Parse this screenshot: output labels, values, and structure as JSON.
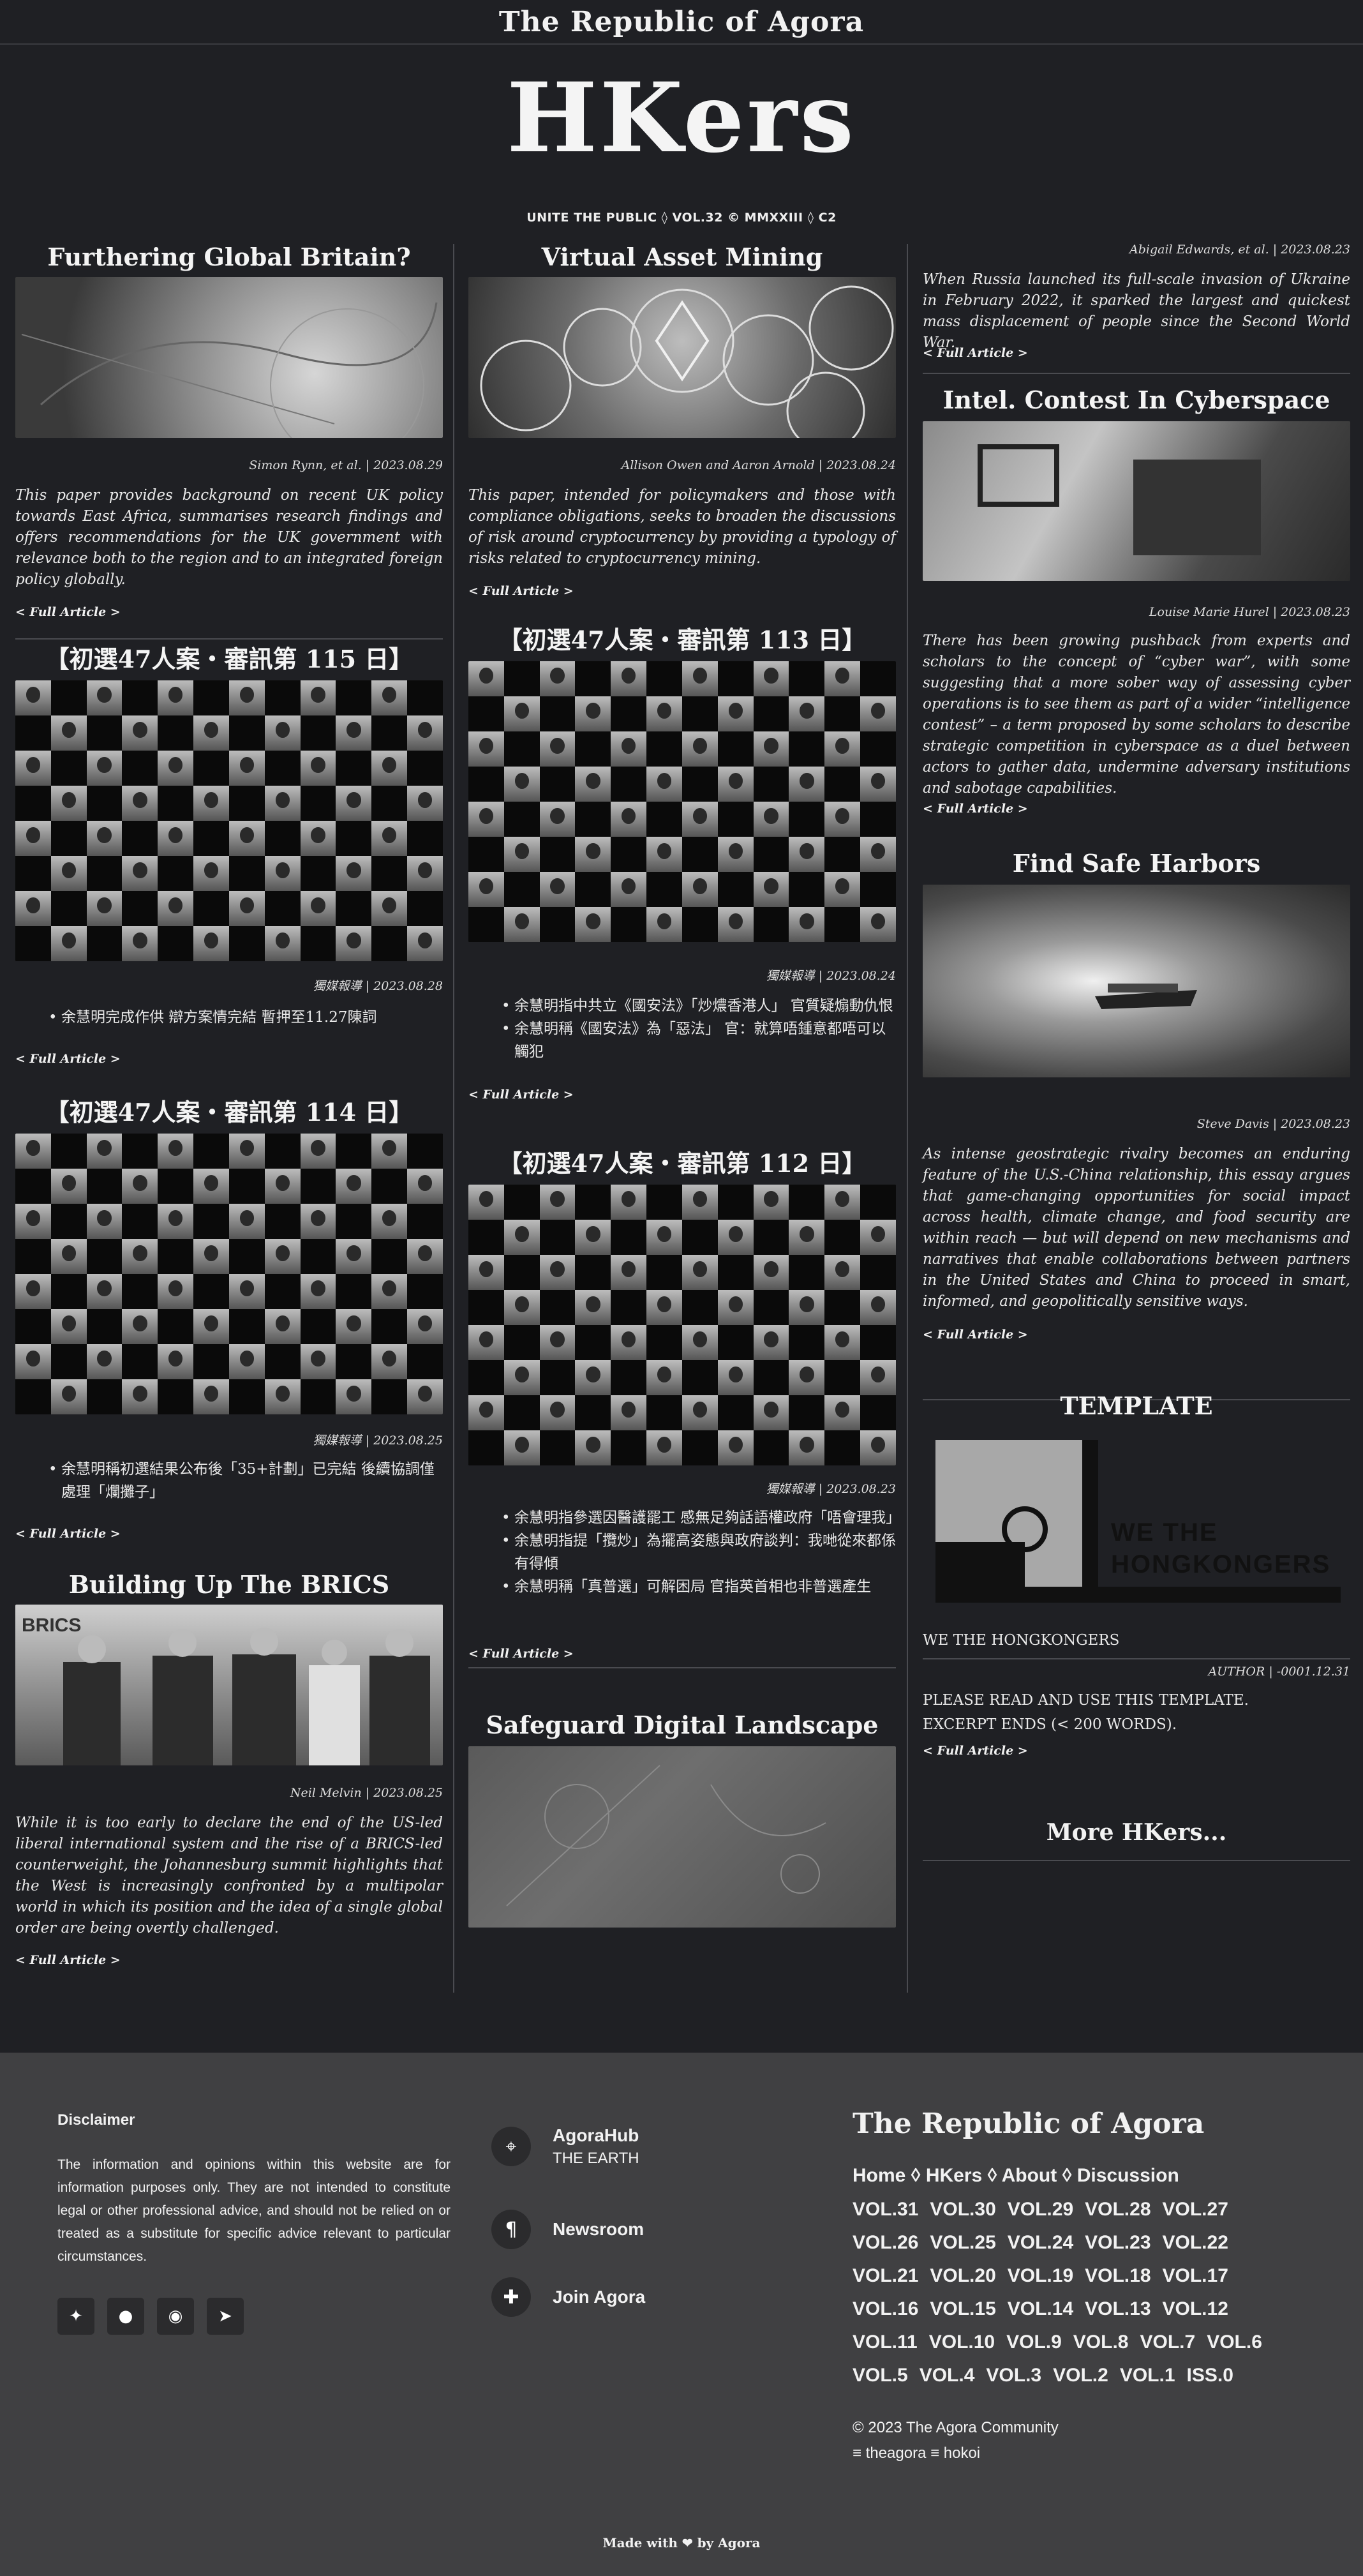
{
  "site": {
    "brand": "The Republic of Agora",
    "logo": "HKers",
    "subtitle": "UNITE THE PUBLIC ◊ VOL.32 © MMXXIII ◊ C2"
  },
  "col1": [
    {
      "title": "Furthering Global Britain?",
      "meta": "Simon Rynn, et al. | 2023.08.29",
      "excerpt": "This paper provides background on recent UK policy towards East Africa, summarises research findings and offers recommendations for the UK government with relevance both to the region and to an integrated foreign policy globally.",
      "more": "< Full Article >"
    },
    {
      "title": "【初選47人案・審訊第 115 日】",
      "meta": "獨媒報導 | 2023.08.28",
      "bullets": [
        "余慧明完成作供 辯方案情完結 暫押至11.27陳詞"
      ],
      "more": "< Full Article >"
    },
    {
      "title": "【初選47人案・審訊第 114 日】",
      "meta": "獨媒報導 | 2023.08.25",
      "bullets": [
        "余慧明稱初選結果公布後「35+計劃」已完結 後續協調僅處理「爛攤子」"
      ],
      "more": "< Full Article >"
    },
    {
      "title": "Building Up The BRICS",
      "meta": "Neil Melvin | 2023.08.25",
      "excerpt": "While it is too early to declare the end of the US-led liberal international system and the rise of a BRICS-led counterweight, the Johannesburg summit highlights that the West is increasingly confronted by a multipolar world in which its position and the idea of a single global order are being overtly challenged.",
      "more": "< Full Article >",
      "image_text": "BRICS"
    }
  ],
  "col2": [
    {
      "title": "Virtual Asset Mining",
      "meta": "Allison Owen and Aaron Arnold | 2023.08.24",
      "excerpt": "This paper, intended for policymakers and those with compliance obligations, seeks to broaden the discussions of risk around cryptocurrency by providing a typology of risks related to cryptocurrency mining.",
      "more": "< Full Article >"
    },
    {
      "title": "【初選47人案・審訊第 113 日】",
      "meta": "獨媒報導 | 2023.08.24",
      "bullets": [
        "余慧明指中共立《國安法》「炒燶香港人」 官質疑煽動仇恨",
        "余慧明稱《國安法》為「惡法」 官：就算唔鍾意都唔可以觸犯"
      ],
      "more": "< Full Article >"
    },
    {
      "title": "【初選47人案・審訊第 112 日】",
      "meta": "獨媒報導 | 2023.08.23",
      "bullets": [
        "余慧明指參選因醫護罷工 感無足夠話語權政府「唔會理我」",
        "余慧明指提「攬炒」為擺高姿態與政府談判：我哋從來都係有得傾",
        "余慧明稱「真普選」可解困局 官指英首相也非普選產生"
      ],
      "more": "< Full Article >"
    },
    {
      "title": "Safeguard Digital Landscape"
    }
  ],
  "col3": [
    {
      "meta": "Abigail Edwards, et al. | 2023.08.23",
      "excerpt": "When Russia launched its full-scale invasion of Ukraine in February 2022, it sparked the largest and quickest mass displacement of people since the Second World War.",
      "more": "< Full Article >"
    },
    {
      "title": "Intel. Contest In Cyberspace",
      "meta": "Louise Marie Hurel | 2023.08.23",
      "excerpt": "There has been growing pushback from experts and scholars to the concept of “cyber war”, with some suggesting that a more sober way of assessing cyber operations is to see them as part of a wider “intelligence contest” – a term proposed by some scholars to describe strategic competition in cyberspace as a duel between actors to gather data, undermine adversary institutions and sabotage capabilities.",
      "more": "< Full Article >"
    },
    {
      "title": "Find Safe Harbors",
      "meta": "Steve Davis | 2023.08.23",
      "excerpt": "As intense geostrategic rivalry becomes an enduring feature of the U.S.-China relationship, this essay argues that game-changing opportunities for social impact across health, climate change, and food security are within reach — but will depend on new mechanisms and narratives that enable collaborations between partners in the United States and China to proceed in smart, informed, and geopolitically sensitive ways.",
      "more": "< Full Article >"
    },
    {
      "title": "TEMPLATE",
      "image_text": "WE THE HONGKONGERS",
      "caption": "WE THE HONGKONGERS",
      "meta": "AUTHOR | -0001.12.31",
      "lines": [
        "PLEASE READ AND USE THIS TEMPLATE.",
        "EXCERPT ENDS (< 200 WORDS)."
      ],
      "more": "< Full Article >"
    }
  ],
  "more_hkers": "More HKers...",
  "footer": {
    "disclaimer_title": "Disclaimer",
    "disclaimer_text": "The information and opinions within this website are for information purposes only. They are not intended to constitute legal or other professional advice, and should not be relied on or treated as a substitute for specific advice relevant to particular circumstances.",
    "social_icons": [
      "twitter-icon",
      "github-icon",
      "reddit-icon",
      "telegram-icon"
    ],
    "links": [
      {
        "label": "AgoraHub",
        "sub": "THE EARTH",
        "icon": "map-pin-icon"
      },
      {
        "label": "Newsroom",
        "icon": "pilcrow-icon"
      },
      {
        "label": "Join Agora",
        "icon": "puzzle-icon"
      }
    ],
    "brand": "The Republic of Agora",
    "nav": "Home ◊ HKers ◊ About ◊ Discussion",
    "volumes": [
      "VOL.31",
      "VOL.30",
      "VOL.29",
      "VOL.28",
      "VOL.27",
      "VOL.26",
      "VOL.25",
      "VOL.24",
      "VOL.23",
      "VOL.22",
      "VOL.21",
      "VOL.20",
      "VOL.19",
      "VOL.18",
      "VOL.17",
      "VOL.16",
      "VOL.15",
      "VOL.14",
      "VOL.13",
      "VOL.12",
      "VOL.11",
      "VOL.10",
      "VOL.9",
      "VOL.8",
      "VOL.7",
      "VOL.6",
      "VOL.5",
      "VOL.4",
      "VOL.3",
      "VOL.2",
      "VOL.1",
      "ISS.0"
    ],
    "copyright": "© 2023 The Agora Community",
    "handles": "≡ theagora ≡ hokoi",
    "made_with": "Made with ❤ by Agora"
  }
}
